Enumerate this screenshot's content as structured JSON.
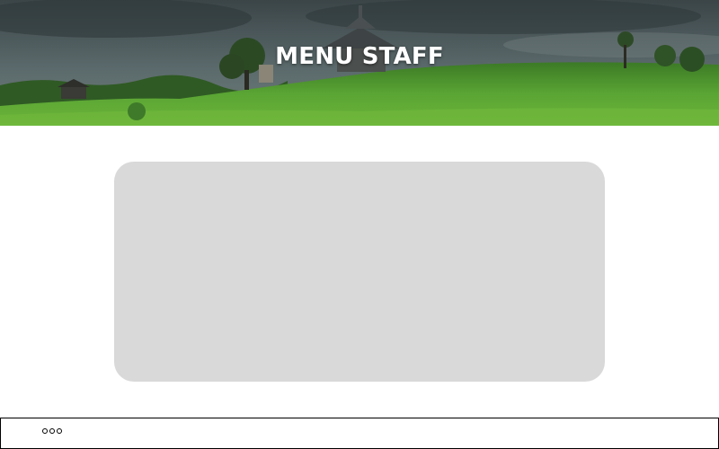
{
  "header": {
    "title": "MENU STAFF"
  },
  "footer": {
    "more_icon": "more-horizontal-icon"
  },
  "colors": {
    "card": "#d9d9d9",
    "grass": "#4f9a2c",
    "sky": "#4a5a5e"
  }
}
